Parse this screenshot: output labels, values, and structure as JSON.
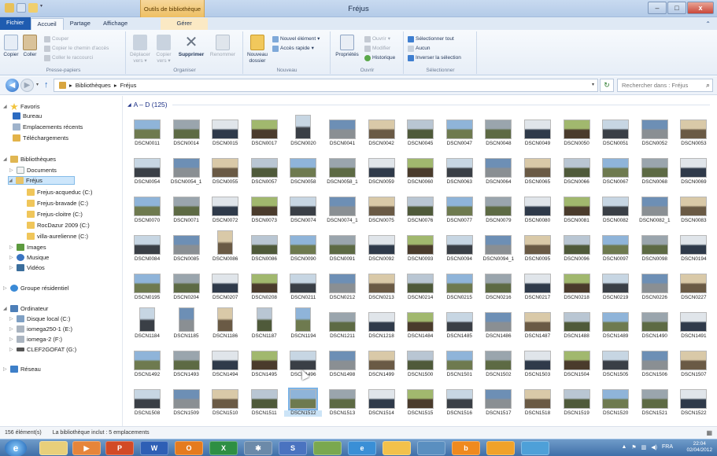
{
  "window": {
    "title": "Fréjus",
    "context_tab_label": "Outils de bibliothèque",
    "minimize": "–",
    "maximize": "□",
    "close": "x"
  },
  "ribbon_tabs": [
    "Fichier",
    "Accueil",
    "Partage",
    "Affichage",
    "Gérer"
  ],
  "ribbon": {
    "presse_papiers": {
      "label": "Presse-papiers",
      "copier": "Copier",
      "coller": "Coller",
      "couper": "Couper",
      "copier_chemin": "Copier le chemin d'accès",
      "coller_raccourci": "Coller le raccourci"
    },
    "organiser": {
      "label": "Organiser",
      "deplacer": "Déplacer vers",
      "copier_vers": "Copier vers",
      "supprimer": "Supprimer",
      "renommer": "Renommer"
    },
    "nouveau": {
      "label": "Nouveau",
      "nouveau_dossier": "Nouveau dossier",
      "nouvel_element": "Nouvel élément",
      "acces_rapide": "Accès rapide"
    },
    "ouvrir": {
      "label": "Ouvrir",
      "proprietes": "Propriétés",
      "ouvrir": "Ouvrir",
      "modifier": "Modifier",
      "historique": "Historique"
    },
    "selectionner": {
      "label": "Sélectionner",
      "tout": "Sélectionner tout",
      "aucun": "Aucun",
      "inverser": "Inverser la sélection"
    }
  },
  "address": {
    "crumbs": [
      "Bibliothèques",
      "Fréjus"
    ],
    "search_placeholder": "Rechercher dans : Fréjus"
  },
  "nav": {
    "favoris": "Favoris",
    "bureau": "Bureau",
    "emplacements": "Emplacements récents",
    "telechargements": "Téléchargements",
    "bibliotheques": "Bibliothèques",
    "documents": "Documents",
    "frejus": "Fréjus",
    "frejus_sub": [
      "Frejus-acqueduc (C:)",
      "Frejus-bravade (C:)",
      "Frejus-cloitre (C:)",
      "RocDazur 2009 (C:)",
      "villa-aurelienne (C:)"
    ],
    "images": "Images",
    "musique": "Musique",
    "videos": "Vidéos",
    "groupe": "Groupe résidentiel",
    "ordinateur": "Ordinateur",
    "drives": [
      "Disque local (C:)",
      "iomega250-1 (E:)",
      "iomega-2 (F:)",
      "CLEF2GOFAT (G:)"
    ],
    "reseau": "Réseau"
  },
  "group_header": "A – D (125)",
  "files": [
    "DSCN0011",
    "DSCN0014",
    "DSCN0015",
    "DSCN0017",
    "DSCN0020",
    "DSCN0041",
    "DSCN0042",
    "DSCN0045",
    "DSCN0047",
    "DSCN0048",
    "DSCN0049",
    "DSCN0050",
    "DSCN0051",
    "DSCN0052",
    "DSCN0053",
    "DSCN0054",
    "DSCN0054_1",
    "DSCN0055",
    "DSCN0057",
    "DSCN0058",
    "DSCN0058_1",
    "DSCN0059",
    "DSCN0060",
    "DSCN0063",
    "DSCN0064",
    "DSCN0065",
    "DSCN0066",
    "DSCN0067",
    "DSCN0068",
    "DSCN0069",
    "DSCN0070",
    "DSCN0071",
    "DSCN0072",
    "DSCN0073",
    "DSCN0074",
    "DSCN0074_1",
    "DSCN0075",
    "DSCN0076",
    "DSCN0077",
    "DSCN0079",
    "DSCN0080",
    "DSCN0081",
    "DSCN0082",
    "DSCN0082_1",
    "DSCN0083",
    "DSCN0084",
    "DSCN0085",
    "DSCN0086",
    "DSCN0086",
    "DSCN0090",
    "DSCN0091",
    "DSCN0092",
    "DSCN0093",
    "DSCN0094",
    "DSCN0094_1",
    "DSCN0095",
    "DSCN0096",
    "DSCN0097",
    "DSCN0098",
    "DSCN0194",
    "DSCN0195",
    "DSCN0204",
    "DSCN0207",
    "DSCN0208",
    "DSCN0211",
    "DSCN0212",
    "DSCN0213",
    "DSCN0214",
    "DSCN0215",
    "DSCN0216",
    "DSCN0217",
    "DSCN0218",
    "DSCN0219",
    "DSCN0226",
    "DSCN0227",
    "DSCN1184",
    "DSCN1185",
    "DSCN1186",
    "DSCN1187",
    "DSCN1194",
    "DSCN1211",
    "DSCN1218",
    "DSCN1484",
    "DSCN1485",
    "DSCN1486",
    "DSCN1487",
    "DSCN1488",
    "DSCN1489",
    "DSCN1490",
    "DSCN1491",
    "DSCN1492",
    "DSCN1493",
    "DSCN1494",
    "DSCN1495",
    "DSCN1496",
    "DSCN1498",
    "DSCN1499",
    "DSCN1500",
    "DSCN1501",
    "DSCN1502",
    "DSCN1503",
    "DSCN1504",
    "DSCN1505",
    "DSCN1506",
    "DSCN1507",
    "DSCN1508",
    "DSCN1509",
    "DSCN1510",
    "DSCN1511",
    "DSCN1512",
    "DSCN1513",
    "DSCN1514",
    "DSCN1515",
    "DSCN1516",
    "DSCN1517",
    "DSCN1518",
    "DSCN1519",
    "DSCN1520",
    "DSCN1521",
    "DSCN1522",
    "",
    "",
    "",
    "",
    "",
    ""
  ],
  "selected_file": "DSCN1512",
  "status": {
    "count": "156 élément(s)",
    "library": "La bibliothèque inclut : 5 emplacements"
  },
  "taskbar": {
    "start": "e",
    "lang": "FRA",
    "time": "22:04",
    "date": "02/04/2012"
  },
  "colors": {
    "accent": "#1f5cb0",
    "context_tab": "#eebf63",
    "selection": "#cce4f7",
    "group_header": "#1e3287"
  }
}
